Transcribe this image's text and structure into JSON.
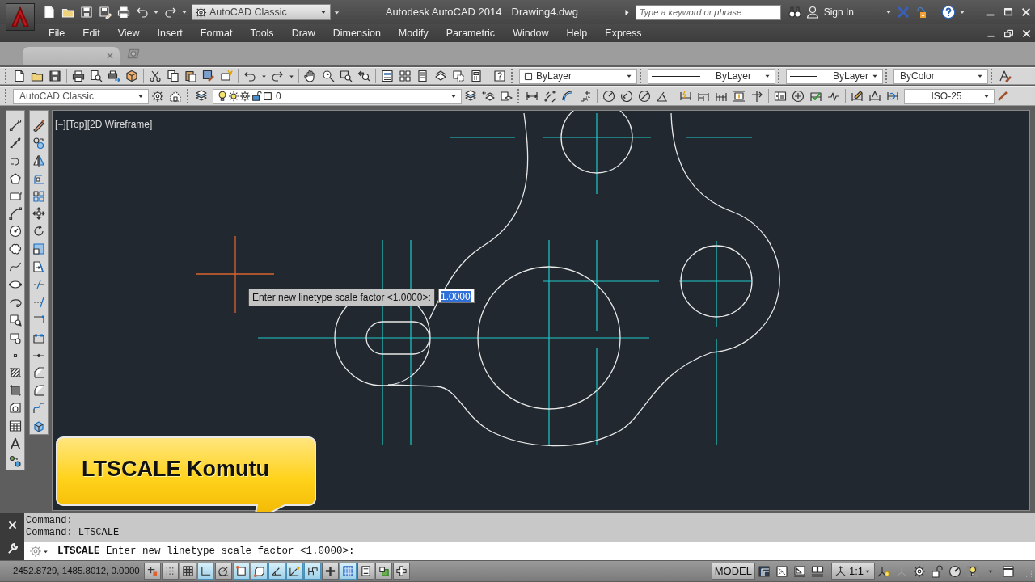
{
  "title_bar": {
    "workspace": "AutoCAD Classic",
    "app_title": "Autodesk AutoCAD 2014",
    "document": "Drawing4.dwg",
    "search": {
      "placeholder": "Type a keyword or phrase"
    },
    "sign_in": "Sign In"
  },
  "menu": [
    "File",
    "Edit",
    "View",
    "Insert",
    "Format",
    "Tools",
    "Draw",
    "Dimension",
    "Modify",
    "Parametric",
    "Window",
    "Help",
    "Express"
  ],
  "properties_toolbar": {
    "color_setting": "ByLayer",
    "linetype": "ByLayer",
    "lineweight": "ByLayer",
    "plot_style": "ByColor"
  },
  "workspaces_toolbar": {
    "workspace": "AutoCAD Classic"
  },
  "layers_toolbar": {
    "layer": "0"
  },
  "styles_toolbar": {
    "dim_style": "ISO-25"
  },
  "viewport_label": "[−][Top][2D Wireframe]",
  "prompt_tooltip": {
    "text": "Enter new linetype scale factor <1.0000>:",
    "value": "1.0000",
    "value_selected": true
  },
  "caption": "LTSCALE Komutu",
  "command_line": {
    "history": [
      "Command:",
      "Command: LTSCALE"
    ],
    "prompt": "**LTSCALE** Enter new linetype scale factor <1.0000>:"
  },
  "status_bar": {
    "coordinates": "2452.8729, 1485.8012, 0.0000",
    "toggles": [
      {
        "on": false
      },
      {
        "on": false
      },
      {
        "on": false
      },
      {
        "on": true
      },
      {
        "on": false
      },
      {
        "on": true
      },
      {
        "on": true
      },
      {
        "on": true
      },
      {
        "on": true
      },
      {
        "on": true
      },
      {
        "on": false
      },
      {
        "on": true
      },
      {
        "on": false
      },
      {
        "on": false
      },
      {
        "on": false
      }
    ],
    "space": "MODEL",
    "annotation_scale": "1:1"
  }
}
